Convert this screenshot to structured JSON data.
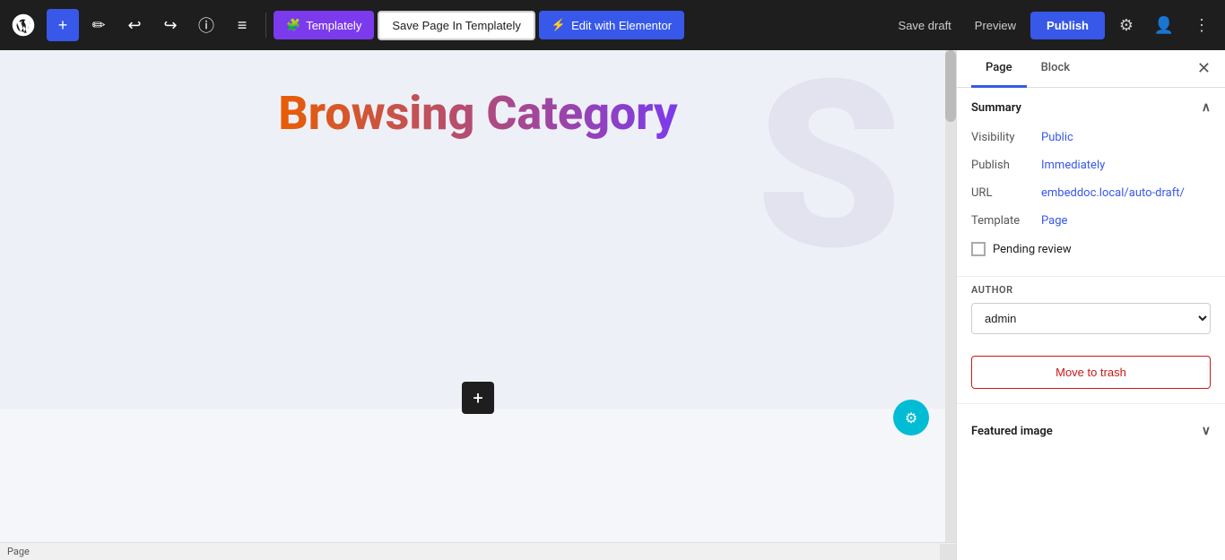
{
  "toolbar": {
    "add_label": "+",
    "tools_label": "✏",
    "undo_label": "↩",
    "redo_label": "↪",
    "info_label": "ⓘ",
    "menu_label": "≡",
    "templately_label": "Templately",
    "save_templately_label": "Save Page In Templately",
    "elementor_label": "Edit with Elementor",
    "save_draft_label": "Save draft",
    "preview_label": "Preview",
    "publish_label": "Publish",
    "settings_icon": "⚙",
    "user_icon": "👤",
    "more_icon": "⋮"
  },
  "canvas": {
    "page_title": "Browsing Category",
    "watermark_text": "S",
    "add_block_icon": "+",
    "elementor_icon": "⚙",
    "status_label": "Page"
  },
  "sidebar": {
    "tabs": [
      {
        "label": "Page",
        "active": true
      },
      {
        "label": "Block",
        "active": false
      }
    ],
    "summary_label": "Summary",
    "visibility_label": "Visibility",
    "visibility_value": "Public",
    "publish_label": "Publish",
    "publish_value": "Immediately",
    "url_label": "URL",
    "url_value": "embeddoc.local/auto-draft/",
    "template_label": "Template",
    "template_value": "Page",
    "pending_review_label": "Pending review",
    "author_section_label": "AUTHOR",
    "author_value": "admin",
    "author_options": [
      "admin"
    ],
    "move_trash_label": "Move to trash",
    "featured_image_label": "Featured image"
  }
}
